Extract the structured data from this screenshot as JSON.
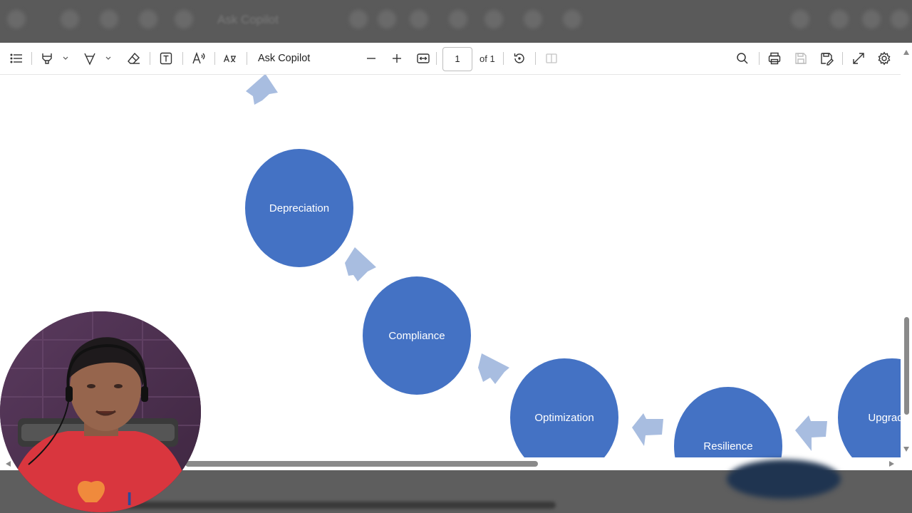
{
  "toolbar": {
    "ask_copilot": "Ask Copilot",
    "page_current": "1",
    "page_total": "of 1"
  },
  "background_toolbar_blurred": {
    "title": "Ask Copilot"
  },
  "diagram": {
    "nodes": [
      {
        "label": "Depreciation"
      },
      {
        "label": "Compliance"
      },
      {
        "label": "Optimization"
      },
      {
        "label": "Resilience"
      },
      {
        "label": "Upgrad"
      }
    ]
  },
  "colors": {
    "node_fill": "#4472c4",
    "arrow_fill": "#a8bde0"
  }
}
